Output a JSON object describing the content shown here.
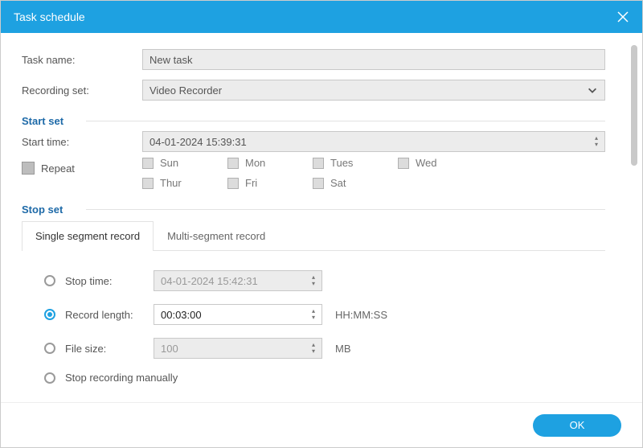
{
  "titlebar": {
    "title": "Task schedule"
  },
  "fields": {
    "task_name_label": "Task name:",
    "task_name_value": "New task",
    "recording_set_label": "Recording set:",
    "recording_set_value": "Video Recorder"
  },
  "start_set": {
    "title": "Start set",
    "start_time_label": "Start time:",
    "start_time_value": "04-01-2024 15:39:31",
    "repeat_label": "Repeat",
    "days": [
      "Sun",
      "Mon",
      "Tues",
      "Wed",
      "Thur",
      "Fri",
      "Sat"
    ]
  },
  "stop_set": {
    "title": "Stop set",
    "tabs": [
      {
        "label": "Single segment record",
        "active": true
      },
      {
        "label": "Multi-segment record",
        "active": false
      }
    ],
    "options": {
      "stop_time_label": "Stop time:",
      "stop_time_value": "04-01-2024 15:42:31",
      "record_length_label": "Record length:",
      "record_length_value": "00:03:00",
      "record_length_unit": "HH:MM:SS",
      "file_size_label": "File size:",
      "file_size_value": "100",
      "file_size_unit": "MB",
      "stop_manual_label": "Stop recording manually",
      "selected": "record_length"
    }
  },
  "footer": {
    "ok": "OK"
  }
}
